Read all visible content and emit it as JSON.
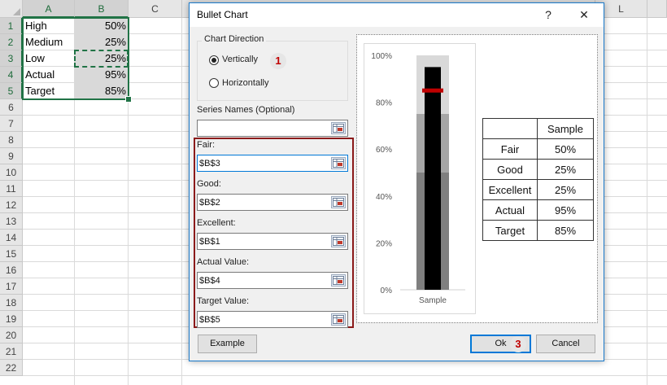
{
  "spreadsheet": {
    "columns": [
      "A",
      "B",
      "C",
      "L"
    ],
    "rows": [
      "1",
      "2",
      "3",
      "4",
      "5",
      "6",
      "7",
      "8",
      "9",
      "10",
      "11",
      "12",
      "13",
      "14",
      "15",
      "16",
      "17",
      "18",
      "19",
      "20",
      "21",
      "22"
    ],
    "cells": [
      {
        "label": "High",
        "value": "50%"
      },
      {
        "label": "Medium",
        "value": "25%"
      },
      {
        "label": "Low",
        "value": "25%"
      },
      {
        "label": "Actual",
        "value": "95%"
      },
      {
        "label": "Target",
        "value": "85%"
      }
    ],
    "accent_color": "#217346"
  },
  "dialog": {
    "title": "Bullet Chart",
    "help_label": "?",
    "close_label": "✕",
    "chart_direction": {
      "label": "Chart Direction",
      "options": [
        "Vertically",
        "Horizontally"
      ],
      "selected": "Vertically"
    },
    "series_names": {
      "label": "Series Names (Optional)",
      "value": ""
    },
    "fields": [
      {
        "label": "Fair:",
        "value": "$B$3"
      },
      {
        "label": "Good:",
        "value": "$B$2"
      },
      {
        "label": "Excellent:",
        "value": "$B$1"
      },
      {
        "label": "Actual Value:",
        "value": "$B$4"
      },
      {
        "label": "Target Value:",
        "value": "$B$5"
      }
    ],
    "badges": [
      "1",
      "2",
      "3"
    ],
    "buttons": {
      "example": "Example",
      "ok": "Ok",
      "cancel": "Cancel"
    },
    "ref_icon": "range-select-icon"
  },
  "preview": {
    "table": {
      "header": "Sample",
      "rows": [
        {
          "name": "Fair",
          "value": "50%"
        },
        {
          "name": "Good",
          "value": "25%"
        },
        {
          "name": "Excellent",
          "value": "25%"
        },
        {
          "name": "Actual",
          "value": "95%"
        },
        {
          "name": "Target",
          "value": "85%"
        }
      ]
    }
  },
  "chart_data": {
    "type": "bar",
    "categories": [
      "Sample"
    ],
    "series": [
      {
        "name": "Fair",
        "values": [
          50
        ]
      },
      {
        "name": "Good",
        "values": [
          25
        ]
      },
      {
        "name": "Excellent",
        "values": [
          25
        ]
      },
      {
        "name": "Actual",
        "values": [
          95
        ]
      },
      {
        "name": "Target",
        "values": [
          85
        ]
      }
    ],
    "ylim": [
      0,
      100
    ],
    "yticks": [
      "0%",
      "20%",
      "40%",
      "60%",
      "80%",
      "100%"
    ],
    "grid": false,
    "colors": {
      "Fair": "#7f7f7f",
      "Good": "#a6a6a6",
      "Excellent": "#d9d9d9",
      "Actual": "#000000",
      "Target": "#c00000"
    }
  }
}
